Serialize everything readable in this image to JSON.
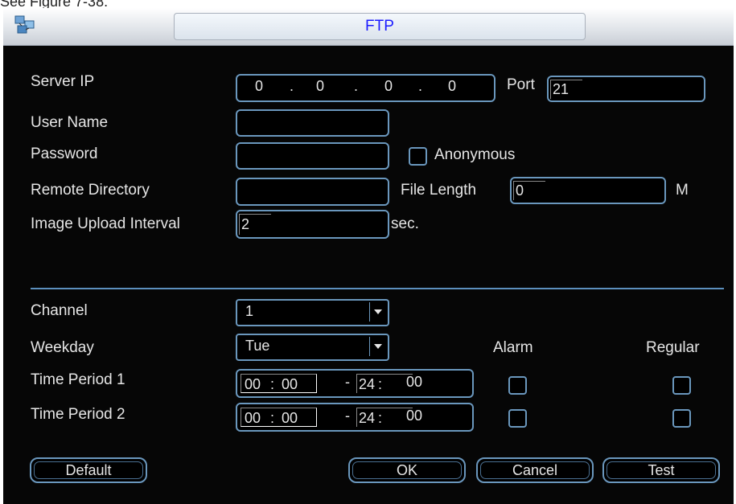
{
  "caption": "See Figure 7-38.",
  "window": {
    "title": "FTP"
  },
  "form": {
    "server_ip_label": "Server IP",
    "ip": [
      "0",
      "0",
      "0",
      "0"
    ],
    "port_label": "Port",
    "port_value": "21",
    "user_name_label": "User Name",
    "user_name_value": "",
    "password_label": "Password",
    "password_value": "",
    "anonymous_label": "Anonymous",
    "anonymous_checked": false,
    "remote_dir_label": "Remote Directory",
    "remote_dir_value": "",
    "file_length_label": "File Length",
    "file_length_value": "0",
    "file_length_unit": "M",
    "upload_interval_label": "Image Upload Interval",
    "upload_interval_value": "2",
    "upload_interval_unit": "sec."
  },
  "schedule": {
    "channel_label": "Channel",
    "channel_value": "1",
    "weekday_label": "Weekday",
    "weekday_value": "Tue",
    "alarm_header": "Alarm",
    "regular_header": "Regular",
    "periods": [
      {
        "label": "Time Period 1",
        "start_h": "00",
        "start_m": "00",
        "end_h": "24",
        "end_m": "00",
        "alarm": false,
        "regular": false
      },
      {
        "label": "Time Period 2",
        "start_h": "00",
        "start_m": "00",
        "end_h": "24",
        "end_m": "00",
        "alarm": false,
        "regular": false
      }
    ]
  },
  "buttons": {
    "default": "Default",
    "ok": "OK",
    "cancel": "Cancel",
    "test": "Test"
  },
  "colors": {
    "panel_bg": "#060606",
    "accent_border": "#6a97bd",
    "title_text": "#1a1aff",
    "text": "#e6e6e6"
  }
}
